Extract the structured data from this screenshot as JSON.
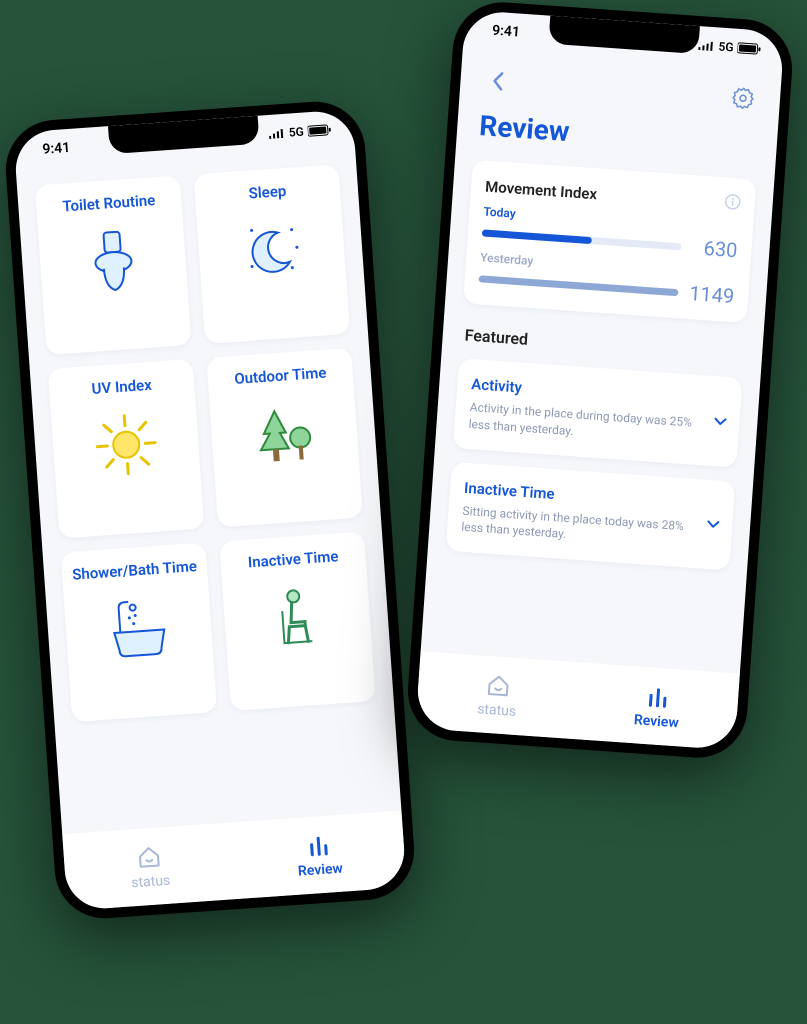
{
  "status": {
    "time": "9:41",
    "network": "5G"
  },
  "leftPhone": {
    "cards": [
      {
        "title": "Toilet Routine",
        "icon": "toilet-icon"
      },
      {
        "title": "Sleep",
        "icon": "moon-icon"
      },
      {
        "title": "UV Index",
        "icon": "sun-icon"
      },
      {
        "title": "Outdoor Time",
        "icon": "tree-icon"
      },
      {
        "title": "Shower/Bath Time",
        "icon": "bath-icon"
      },
      {
        "title": "Inactive Time",
        "icon": "sitting-icon"
      }
    ]
  },
  "rightPhone": {
    "title": "Review",
    "movementIndex": {
      "title": "Movement Index",
      "todayLabel": "Today",
      "todayValue": "630",
      "yesterdayLabel": "Yesterday",
      "yesterdayValue": "1149"
    },
    "featuredHeading": "Featured",
    "featured": [
      {
        "title": "Activity",
        "desc": "Activity in the place during today was 25% less than yesterday."
      },
      {
        "title": "Inactive Time",
        "desc": "Sitting activity in the place today was 28% less than yesterday."
      }
    ]
  },
  "nav": {
    "status": "status",
    "review": "Review"
  }
}
